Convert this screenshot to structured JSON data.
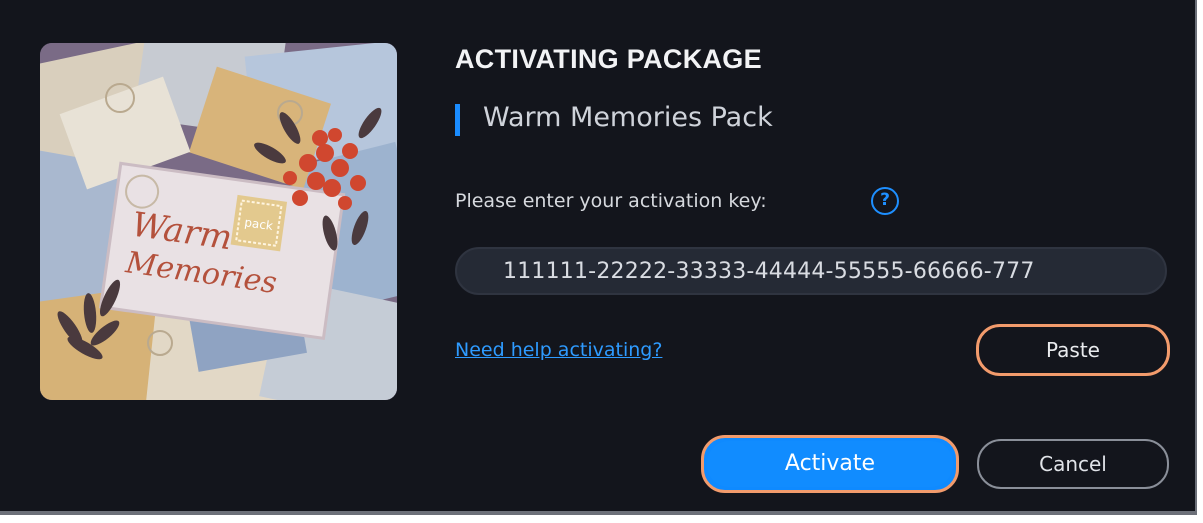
{
  "dialog": {
    "title": "ACTIVATING PACKAGE",
    "package_name": "Warm Memories Pack",
    "prompt": "Please enter your activation key:",
    "help_icon_glyph": "?",
    "activation_key_value": "111111-22222-33333-44444-55555-66666-777",
    "help_link": "Need help activating?",
    "paste_label": "Paste",
    "activate_label": "Activate",
    "cancel_label": "Cancel"
  },
  "artwork": {
    "line1": "Warm",
    "line2": "Memories",
    "badge": "pack"
  },
  "colors": {
    "background": "#13151c",
    "accent_blue": "#118cff",
    "highlight_orange": "#f29b6c",
    "link_blue": "#2e9bff"
  },
  "icons": {
    "help": "question-circle-icon"
  }
}
